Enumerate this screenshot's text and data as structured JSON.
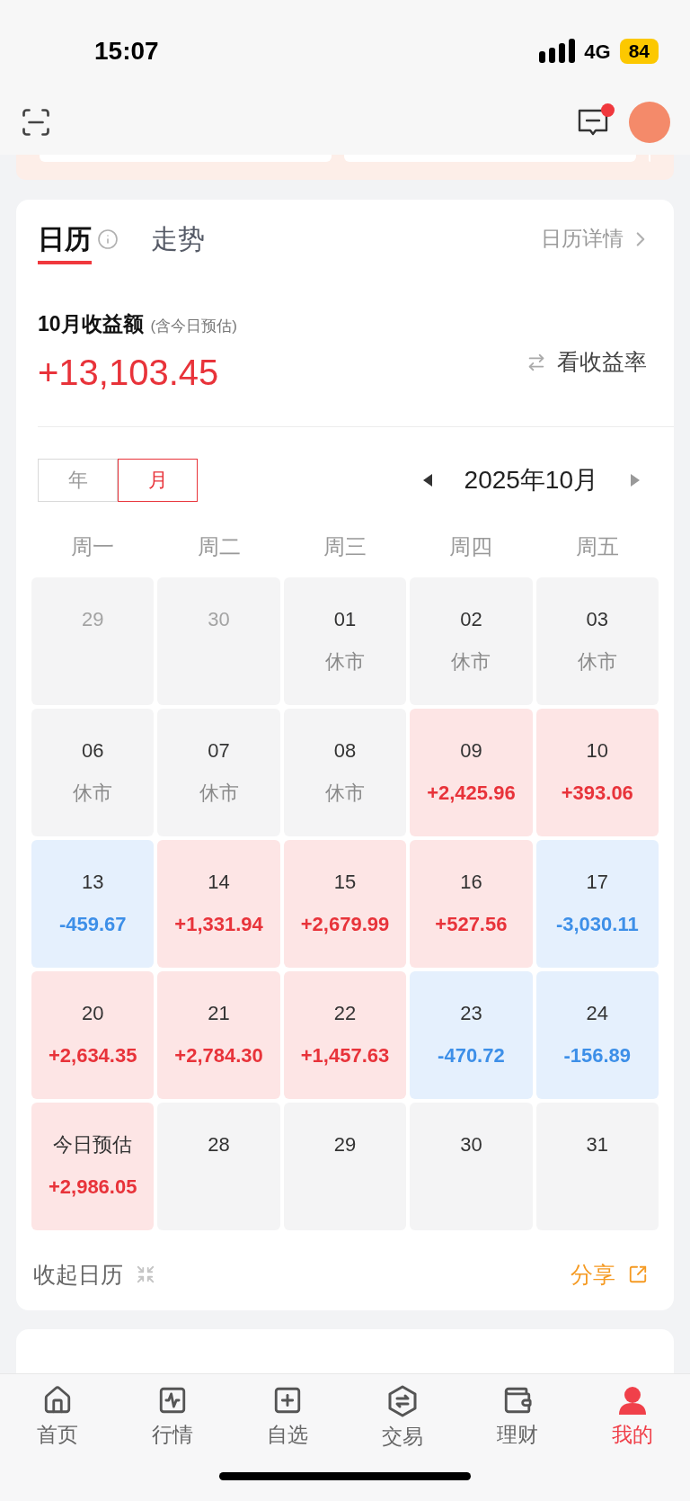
{
  "status_bar": {
    "time": "15:07",
    "network": "4G",
    "battery": "84"
  },
  "calendar_card": {
    "tabs": [
      {
        "label": "日历",
        "selected": true,
        "info": true
      },
      {
        "label": "走势",
        "selected": false,
        "info": false
      }
    ],
    "detail_link": "日历详情",
    "earnings_label": "10月收益额",
    "earnings_note": "(含今日预估)",
    "earnings_value": "+13,103.45",
    "toggle_rate": "看收益率",
    "period_toggle": [
      {
        "label": "年",
        "selected": false
      },
      {
        "label": "月",
        "selected": true
      }
    ],
    "month": "2025年10月",
    "weekdays": [
      "周一",
      "周二",
      "周三",
      "周四",
      "周五"
    ],
    "days": [
      {
        "day": "29",
        "kind": "other"
      },
      {
        "day": "30",
        "kind": "other"
      },
      {
        "day": "01",
        "kind": "closed",
        "note": "休市"
      },
      {
        "day": "02",
        "kind": "closed",
        "note": "休市"
      },
      {
        "day": "03",
        "kind": "closed",
        "note": "休市"
      },
      {
        "day": "06",
        "kind": "closed",
        "note": "休市"
      },
      {
        "day": "07",
        "kind": "closed",
        "note": "休市"
      },
      {
        "day": "08",
        "kind": "closed",
        "note": "休市"
      },
      {
        "day": "09",
        "kind": "gain",
        "note": "+2,425.96"
      },
      {
        "day": "10",
        "kind": "gain",
        "note": "+393.06"
      },
      {
        "day": "13",
        "kind": "loss",
        "note": "-459.67"
      },
      {
        "day": "14",
        "kind": "gain",
        "note": "+1,331.94"
      },
      {
        "day": "15",
        "kind": "gain",
        "note": "+2,679.99"
      },
      {
        "day": "16",
        "kind": "gain",
        "note": "+527.56"
      },
      {
        "day": "17",
        "kind": "loss",
        "note": "-3,030.11"
      },
      {
        "day": "20",
        "kind": "gain",
        "note": "+2,634.35"
      },
      {
        "day": "21",
        "kind": "gain",
        "note": "+2,784.30"
      },
      {
        "day": "22",
        "kind": "gain",
        "note": "+1,457.63"
      },
      {
        "day": "23",
        "kind": "loss",
        "note": "-470.72"
      },
      {
        "day": "24",
        "kind": "loss",
        "note": "-156.89"
      },
      {
        "day": "今日预估",
        "kind": "gain",
        "note": "+2,986.05"
      },
      {
        "day": "28",
        "kind": "future"
      },
      {
        "day": "29",
        "kind": "future"
      },
      {
        "day": "30",
        "kind": "future"
      },
      {
        "day": "31",
        "kind": "future"
      }
    ],
    "collapse": "收起日历",
    "share": "分享"
  },
  "bottom_nav": [
    {
      "label": "首页",
      "selected": false
    },
    {
      "label": "行情",
      "selected": false
    },
    {
      "label": "自选",
      "selected": false
    },
    {
      "label": "交易",
      "selected": false
    },
    {
      "label": "理财",
      "selected": false
    },
    {
      "label": "我的",
      "selected": true
    }
  ]
}
